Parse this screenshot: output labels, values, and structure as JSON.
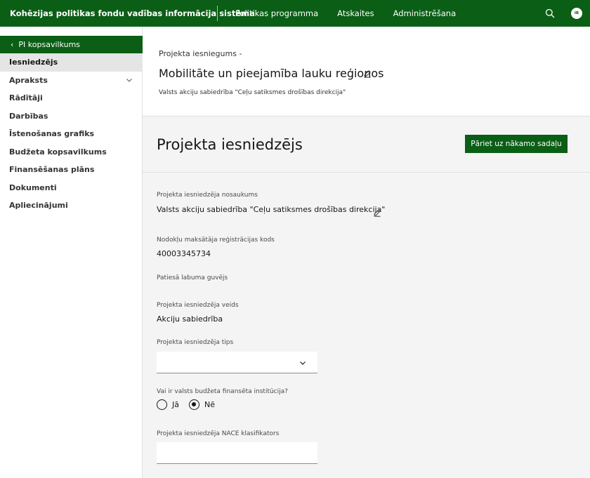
{
  "topbar": {
    "app_title": "Kohēzijas politikas fondu vadības informācija sistēma",
    "nav": [
      "Politikas programma",
      "Atskaites",
      "Administrēšana"
    ],
    "search_icon": "search-icon",
    "avatar_initials": "IB"
  },
  "sidebar": {
    "back_label": "PI kopsavilkums",
    "items": [
      {
        "label": "Iesniedzējs",
        "active": true
      },
      {
        "label": "Apraksts",
        "expandable": true
      },
      {
        "label": "Rādītāji"
      },
      {
        "label": "Darbības"
      },
      {
        "label": "Īstenošanas grafiks"
      },
      {
        "label": "Budžeta kopsavilkums"
      },
      {
        "label": "Finansēšanas plāns"
      },
      {
        "label": "Dokumenti"
      },
      {
        "label": "Apliecinājumi"
      }
    ]
  },
  "header": {
    "breadcrumb": "Projekta iesniegums -",
    "title": "Mobilitāte un pieejamība lauku reģionos",
    "subtitle": "Valsts akciju sabiedrība \"Ceļu satiksmes drošības direkcija\""
  },
  "section": {
    "title": "Projekta iesniedzējs",
    "next_button": "Pāriet uz nākamo sadaļu"
  },
  "form": {
    "name_label": "Projekta iesniedzēja nosaukums",
    "name_value": "Valsts akciju sabiedrība \"Ceļu satiksmes drošības direkcija\"",
    "reg_label": "Nodokļu maksātāja reģistrācijas kods",
    "reg_value": "40003345734",
    "beneficiary_label": "Patiesā labuma guvējs",
    "type_label": "Projekta iesniedzēja veids",
    "type_value": "Akciju sabiedrība",
    "kind_label": "Projekta iesniedzēja tips",
    "kind_value": "",
    "budget_label": "Vai ir valsts budžeta finansēta institūcija?",
    "radio_yes": "Jā",
    "radio_no": "Nē",
    "radio_selected": "no",
    "nace_label": "Projekta iesniedzēja NACE klasifikators",
    "nace_value": ""
  },
  "colors": {
    "brand_green": "#0b5e15",
    "panel_bg": "#f4f4f4"
  }
}
